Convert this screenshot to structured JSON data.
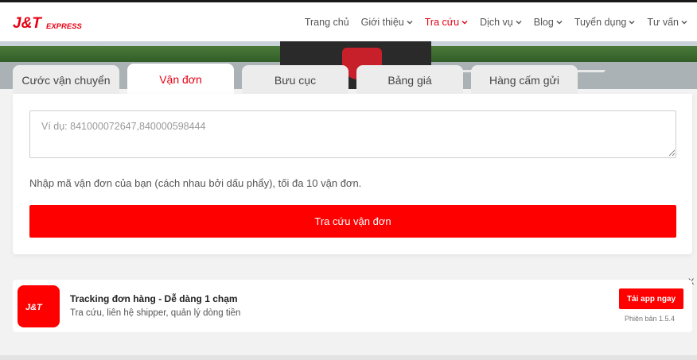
{
  "brand": {
    "logo_text": "J&T",
    "logo_sub": "EXPRESS",
    "accent": "#e60012",
    "button_red": "#ff0000"
  },
  "nav": {
    "items": [
      {
        "label": "Trang chủ",
        "has_dropdown": false
      },
      {
        "label": "Giới thiệu",
        "has_dropdown": true
      },
      {
        "label": "Tra cứu",
        "has_dropdown": true,
        "active": true
      },
      {
        "label": "Dịch vụ",
        "has_dropdown": true
      },
      {
        "label": "Blog",
        "has_dropdown": true
      },
      {
        "label": "Tuyển dụng",
        "has_dropdown": true
      },
      {
        "label": "Tư vấn",
        "has_dropdown": true
      }
    ]
  },
  "tabs": [
    {
      "label": "Cước vận chuyển"
    },
    {
      "label": "Vận đơn",
      "active": true
    },
    {
      "label": "Bưu cục"
    },
    {
      "label": "Bảng giá"
    },
    {
      "label": "Hàng cấm gửi"
    }
  ],
  "tracking": {
    "value": "",
    "placeholder": "Ví dụ: 841000072647,840000598444",
    "hint": "Nhập mã vận đơn của bạn (cách nhau bởi dấu phẩy), tối đa 10 vận đơn.",
    "submit_label": "Tra cứu vận đơn"
  },
  "promo": {
    "close_label": "X",
    "logo_text": "J&T",
    "title": "Tracking đơn hàng - Dễ dàng 1 chạm",
    "subtitle": "Tra cứu, liên hệ shipper, quản lý dòng tiền",
    "button_label": "Tải app ngay",
    "version": "Phiên bản 1.5.4"
  }
}
